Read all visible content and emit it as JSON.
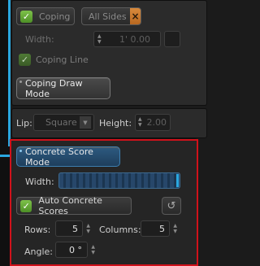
{
  "coping": {
    "coping_label": "Coping",
    "all_sides_label": "All Sides",
    "all_sides_close": "×",
    "width_label": "Width:",
    "width_value": "1' 0.00",
    "coping_line_label": "Coping Line",
    "draw_mode_label": "Coping Draw Mode"
  },
  "lip": {
    "lip_label": "Lip:",
    "lip_value": "Square",
    "height_label": "Height:",
    "height_value": "2.00"
  },
  "score": {
    "mode_label": "Concrete Score Mode",
    "width_label": "Width:",
    "width_fill": 1.0,
    "auto_label": "Auto Concrete Scores",
    "rows_label": "Rows:",
    "rows_value": "5",
    "columns_label": "Columns:",
    "columns_value": "5",
    "angle_label": "Angle:",
    "angle_value": "0 °"
  },
  "colors": {
    "accent_blue": "#2aa7e0",
    "highlight_red": "#d0121b",
    "check_green": "#6db33f"
  }
}
